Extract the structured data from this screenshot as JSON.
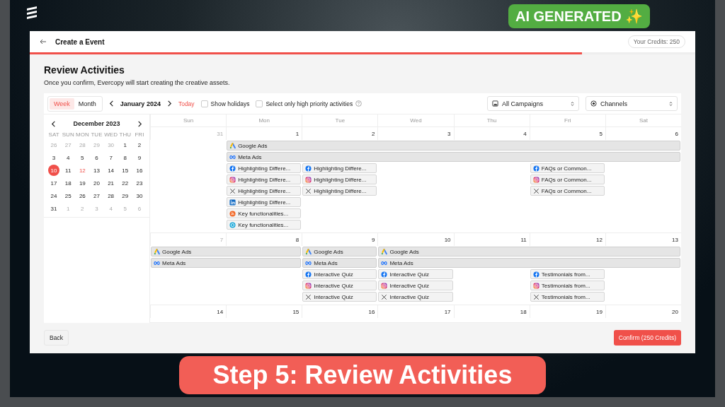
{
  "badge": {
    "text": "AI GENERATED ✨"
  },
  "banner": {
    "text": "Step 5: Review Activities"
  },
  "header": {
    "title": "Create a Event",
    "credits": "Your Credits: 250"
  },
  "progress": {
    "level": 0.83
  },
  "page": {
    "title": "Review Activities",
    "subtitle": "Once you confirm, Evercopy will start creating the creative assets."
  },
  "toolbar": {
    "view_tabs": [
      {
        "label": "Week",
        "selected": true
      },
      {
        "label": "Month",
        "selected": false
      }
    ],
    "period": "January 2024",
    "today": "Today",
    "checkboxes": [
      {
        "label": "Show holidays",
        "checked": false
      },
      {
        "label": "Select only high priority activities",
        "checked": false
      }
    ],
    "selects": [
      "All Campaigns",
      "Channels"
    ]
  },
  "mini_calendar": {
    "month": "December 2023",
    "weekdays": [
      "SAT",
      "SUN",
      "MON",
      "TUE",
      "WED",
      "THU",
      "FRI"
    ],
    "weeks": [
      [
        {
          "label": "26",
          "kind": "outside"
        },
        {
          "label": "27",
          "kind": "outside"
        },
        {
          "label": "28",
          "kind": "outside"
        },
        {
          "label": "29",
          "kind": "outside"
        },
        {
          "label": "30",
          "kind": "outside"
        },
        {
          "label": "1",
          "kind": "normal"
        },
        {
          "label": "2",
          "kind": "normal"
        }
      ],
      [
        {
          "label": "3",
          "kind": "normal"
        },
        {
          "label": "4",
          "kind": "normal"
        },
        {
          "label": "5",
          "kind": "normal"
        },
        {
          "label": "6",
          "kind": "normal"
        },
        {
          "label": "7",
          "kind": "normal"
        },
        {
          "label": "8",
          "kind": "normal"
        },
        {
          "label": "9",
          "kind": "normal"
        }
      ],
      [
        {
          "label": "10",
          "kind": "selected"
        },
        {
          "label": "11",
          "kind": "normal"
        },
        {
          "label": "12",
          "kind": "today"
        },
        {
          "label": "13",
          "kind": "normal"
        },
        {
          "label": "14",
          "kind": "normal"
        },
        {
          "label": "15",
          "kind": "normal"
        },
        {
          "label": "16",
          "kind": "normal"
        }
      ],
      [
        {
          "label": "17",
          "kind": "normal"
        },
        {
          "label": "18",
          "kind": "normal"
        },
        {
          "label": "19",
          "kind": "normal"
        },
        {
          "label": "20",
          "kind": "normal"
        },
        {
          "label": "21",
          "kind": "normal"
        },
        {
          "label": "22",
          "kind": "normal"
        },
        {
          "label": "23",
          "kind": "normal"
        }
      ],
      [
        {
          "label": "24",
          "kind": "normal"
        },
        {
          "label": "25",
          "kind": "normal"
        },
        {
          "label": "26",
          "kind": "normal"
        },
        {
          "label": "27",
          "kind": "normal"
        },
        {
          "label": "28",
          "kind": "normal"
        },
        {
          "label": "29",
          "kind": "normal"
        },
        {
          "label": "30",
          "kind": "normal"
        }
      ],
      [
        {
          "label": "31",
          "kind": "normal"
        },
        {
          "label": "1",
          "kind": "outside"
        },
        {
          "label": "2",
          "kind": "outside"
        },
        {
          "label": "3",
          "kind": "outside"
        },
        {
          "label": "4",
          "kind": "outside"
        },
        {
          "label": "5",
          "kind": "outside"
        },
        {
          "label": "6",
          "kind": "outside"
        }
      ]
    ]
  },
  "calendar": {
    "weekdays": [
      "Sun",
      "Mon",
      "Tue",
      "Wed",
      "Thu",
      "Fri",
      "Sat"
    ],
    "weeks": [
      {
        "days": [
          {
            "label": "31",
            "muted": true
          },
          {
            "label": "1",
            "muted": false
          },
          {
            "label": "2",
            "muted": false
          },
          {
            "label": "3",
            "muted": false
          },
          {
            "label": "4",
            "muted": false
          },
          {
            "label": "5",
            "muted": false
          },
          {
            "label": "6",
            "muted": false
          }
        ],
        "lanes": [
          [
            {
              "kind": "empty"
            },
            {
              "kind": "google_ads",
              "label": "Google Ads"
            },
            {
              "kind": "continued"
            },
            {
              "kind": "continued"
            },
            {
              "kind": "continued"
            },
            {
              "kind": "continued"
            },
            {
              "kind": "continued"
            }
          ],
          [
            {
              "kind": "empty"
            },
            {
              "kind": "meta",
              "label": "Meta Ads"
            },
            {
              "kind": "continued"
            },
            {
              "kind": "continued"
            },
            {
              "kind": "continued"
            },
            {
              "kind": "continued"
            },
            {
              "kind": "continued"
            }
          ],
          [
            {
              "kind": "empty"
            },
            {
              "kind": "facebook",
              "label": "Highlighting Differe..."
            },
            {
              "kind": "facebook",
              "label": "Highlighting Differe..."
            },
            {
              "kind": "empty"
            },
            {
              "kind": "empty"
            },
            {
              "kind": "facebook",
              "label": "FAQs or Common..."
            },
            {
              "kind": "empty"
            }
          ],
          [
            {
              "kind": "empty"
            },
            {
              "kind": "instagram",
              "label": "Highlighting Differe..."
            },
            {
              "kind": "instagram",
              "label": "Highlighting Differe..."
            },
            {
              "kind": "empty"
            },
            {
              "kind": "empty"
            },
            {
              "kind": "instagram",
              "label": "FAQs or Common..."
            },
            {
              "kind": "empty"
            }
          ],
          [
            {
              "kind": "empty"
            },
            {
              "kind": "x",
              "label": "Highlighting Differe..."
            },
            {
              "kind": "x",
              "label": "Highlighting Differe..."
            },
            {
              "kind": "empty"
            },
            {
              "kind": "empty"
            },
            {
              "kind": "x",
              "label": "FAQs or Common..."
            },
            {
              "kind": "empty"
            }
          ],
          [
            {
              "kind": "empty"
            },
            {
              "kind": "linkedin",
              "label": "Highlighting Differe..."
            }
          ],
          [
            {
              "kind": "empty"
            },
            {
              "kind": "rss",
              "label": "Key functionalities..."
            }
          ],
          [
            {
              "kind": "empty"
            },
            {
              "kind": "chat",
              "label": "Key functionalities..."
            }
          ]
        ]
      },
      {
        "days": [
          {
            "label": "7",
            "muted": true
          },
          {
            "label": "8",
            "muted": false
          },
          {
            "label": "9",
            "muted": false
          },
          {
            "label": "10",
            "muted": false
          },
          {
            "label": "11",
            "muted": false
          },
          {
            "label": "12",
            "muted": false
          },
          {
            "label": "13",
            "muted": false
          }
        ],
        "lanes": [
          [
            {
              "kind": "google_ads",
              "label": "Google Ads"
            },
            {
              "kind": "continued"
            },
            {
              "kind": "google_ads",
              "label": "Google Ads"
            },
            {
              "kind": "google_ads",
              "label": "Google Ads"
            },
            {
              "kind": "continued"
            },
            {
              "kind": "continued"
            },
            {
              "kind": "continued"
            }
          ],
          [
            {
              "kind": "meta",
              "label": "Meta Ads"
            },
            {
              "kind": "continued"
            },
            {
              "kind": "meta",
              "label": "Meta Ads"
            },
            {
              "kind": "meta",
              "label": "Meta Ads"
            },
            {
              "kind": "continued"
            },
            {
              "kind": "continued"
            },
            {
              "kind": "continued"
            }
          ],
          [
            {
              "kind": "empty"
            },
            {
              "kind": "empty"
            },
            {
              "kind": "facebook",
              "label": "Interactive Quiz"
            },
            {
              "kind": "facebook",
              "label": "Interactive Quiz"
            },
            {
              "kind": "empty"
            },
            {
              "kind": "facebook",
              "label": "Testimonials from..."
            },
            {
              "kind": "empty"
            }
          ],
          [
            {
              "kind": "empty"
            },
            {
              "kind": "empty"
            },
            {
              "kind": "instagram",
              "label": "Interactive Quiz"
            },
            {
              "kind": "instagram",
              "label": "Interactive Quiz"
            },
            {
              "kind": "empty"
            },
            {
              "kind": "instagram",
              "label": "Testimonials from..."
            },
            {
              "kind": "empty"
            }
          ],
          [
            {
              "kind": "empty"
            },
            {
              "kind": "empty"
            },
            {
              "kind": "x",
              "label": "Interactive Quiz"
            },
            {
              "kind": "x",
              "label": "Interactive Quiz"
            },
            {
              "kind": "empty"
            },
            {
              "kind": "x",
              "label": "Testimonials from..."
            },
            {
              "kind": "empty"
            }
          ]
        ]
      },
      {
        "days": [
          {
            "label": "14",
            "muted": false
          },
          {
            "label": "15",
            "muted": false
          },
          {
            "label": "16",
            "muted": false
          },
          {
            "label": "17",
            "muted": false
          },
          {
            "label": "18",
            "muted": false
          },
          {
            "label": "19",
            "muted": false
          },
          {
            "label": "20",
            "muted": false
          }
        ]
      }
    ]
  },
  "footer": {
    "back": "Back",
    "confirm": "Confirm (250 Credits)"
  }
}
